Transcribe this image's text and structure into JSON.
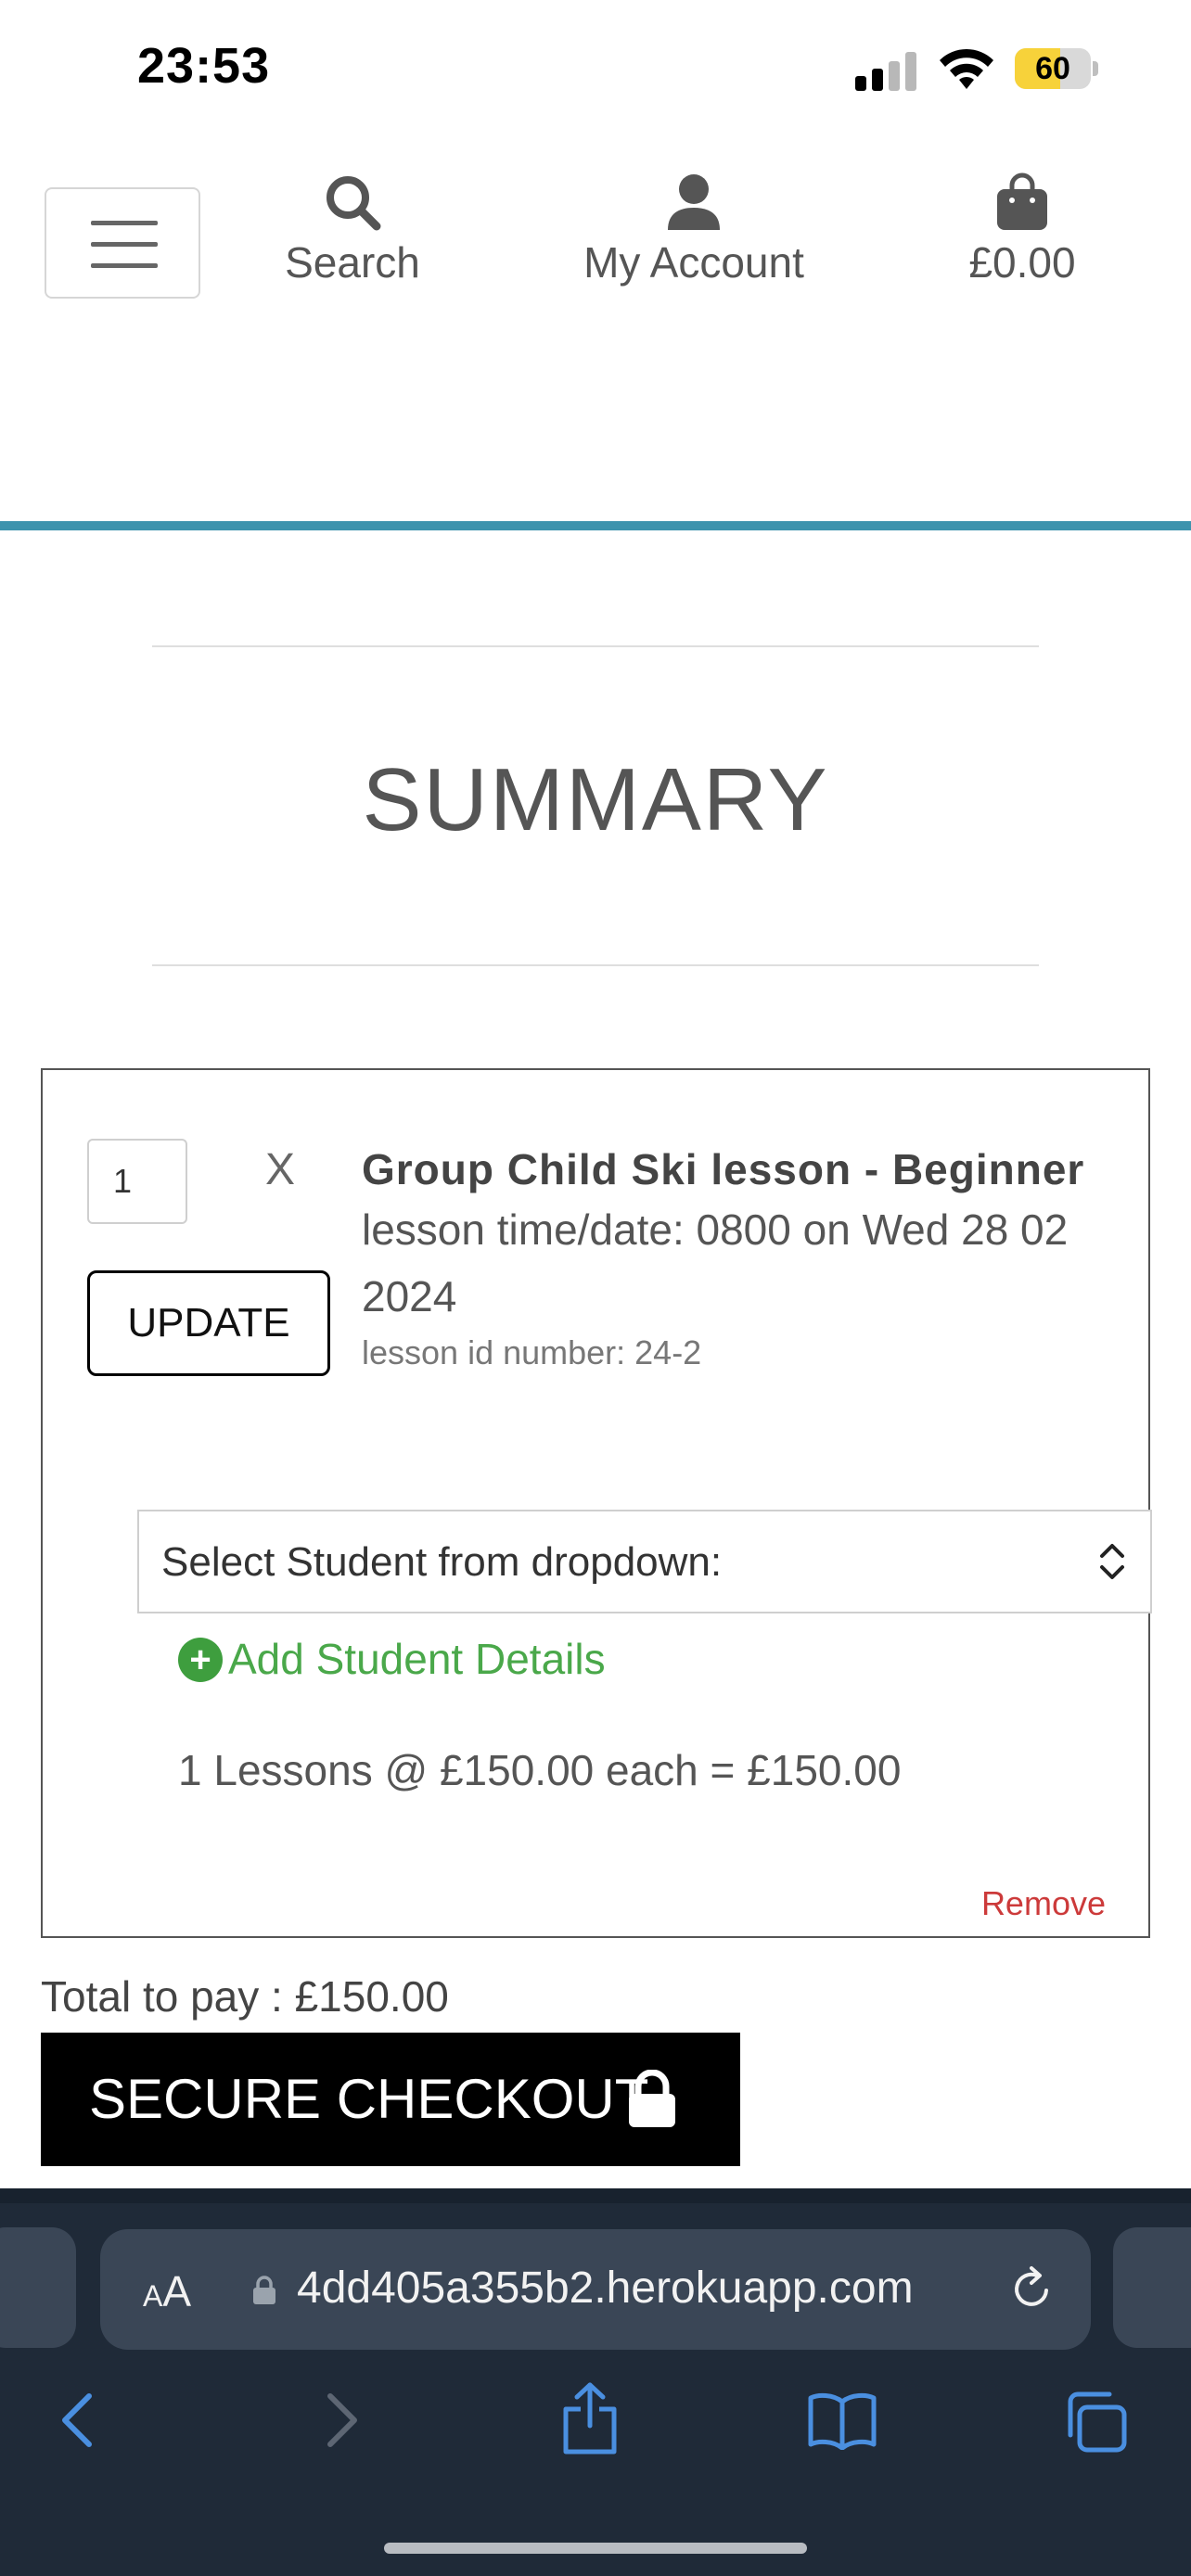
{
  "status_bar": {
    "time": "23:53",
    "battery": "60",
    "battery_level": 0.6
  },
  "nav": {
    "search_label": "Search",
    "account_label": "My Account",
    "cart_total": "£0.00"
  },
  "summary": {
    "title": "SUMMARY"
  },
  "cart_item": {
    "quantity": "1",
    "times_symbol": "X",
    "update_label": "UPDATE",
    "product_name": "Group Child Ski lesson - Beginner",
    "lesson_time_line1": "lesson time/date: 0800 on Wed 28 02",
    "lesson_time_line2": "2024",
    "lesson_id": "lesson id number: 24-2",
    "student_select_placeholder": "Select Student from dropdown:",
    "add_student_label": "Add Student Details",
    "lesson_calc": "1 Lessons @ £150.00 each = £150.00",
    "remove_label": "Remove"
  },
  "checkout": {
    "total_label": "Total to pay : £150.00",
    "button_label": "SECURE CHECKOUT"
  },
  "browser": {
    "aa_small": "A",
    "aa_large": "A",
    "url": "4dd405a355b2.herokuapp.com"
  },
  "colors": {
    "accent": "#3d93ad",
    "add_student": "#4aa84a",
    "remove": "#cc3a3a",
    "checkout_bg": "#000000",
    "safari_bar": "#1f2a38",
    "browser_icons": "#4a8fe0"
  }
}
